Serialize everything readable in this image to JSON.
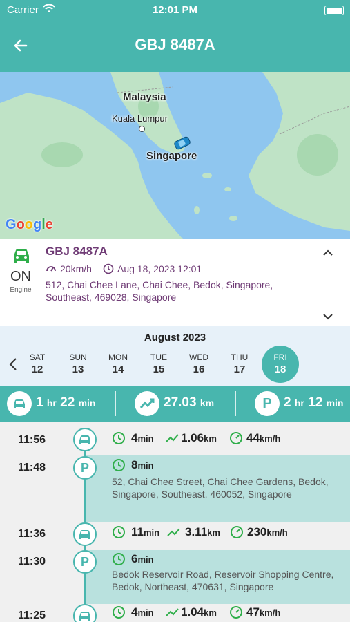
{
  "status_bar": {
    "carrier": "Carrier",
    "time": "12:01 PM"
  },
  "header": {
    "title": "GBJ 8487A",
    "back_icon": "back-arrow-icon"
  },
  "map": {
    "labels": {
      "country": "Malaysia",
      "capital": "Kuala Lumpur",
      "city": "Singapore"
    },
    "provider": "Google"
  },
  "vehicle": {
    "plate": "GBJ 8487A",
    "engine_state": "ON",
    "engine_label": "Engine",
    "speed": "20km/h",
    "timestamp": "Aug 18, 2023 12:01",
    "address": "512, Chai Chee Lane, Chai Chee, Bedok, Singapore, Southeast, 469028, Singapore"
  },
  "calendar": {
    "month": "August 2023",
    "days": [
      {
        "name": "SAT",
        "date": "12"
      },
      {
        "name": "SUN",
        "date": "13"
      },
      {
        "name": "MON",
        "date": "14"
      },
      {
        "name": "TUE",
        "date": "15"
      },
      {
        "name": "WED",
        "date": "16"
      },
      {
        "name": "THU",
        "date": "17"
      },
      {
        "name": "FRI",
        "date": "18"
      }
    ],
    "selected": "FRI 18"
  },
  "summary": {
    "drive": {
      "h": "1",
      "h_unit": "hr",
      "m": "22",
      "m_unit": "min"
    },
    "distance": {
      "value": "27.03",
      "unit": "km"
    },
    "parked": {
      "h": "2",
      "h_unit": "hr",
      "m": "12",
      "m_unit": "min"
    }
  },
  "timeline": [
    {
      "time": "11:56",
      "type": "drive",
      "duration": "4",
      "duration_unit": "min",
      "distance": "1.06",
      "distance_unit": "km",
      "speed": "44",
      "speed_unit": "km/h"
    },
    {
      "time": "11:48",
      "type": "park",
      "duration": "8",
      "duration_unit": "min",
      "address": "52, Chai Chee Street, Chai Chee Gardens, Bedok, Singapore, Southeast, 460052, Singapore"
    },
    {
      "time": "11:36",
      "type": "drive",
      "duration": "11",
      "duration_unit": "min",
      "distance": "3.11",
      "distance_unit": "km",
      "speed": "230",
      "speed_unit": "km/h"
    },
    {
      "time": "11:30",
      "type": "park",
      "duration": "6",
      "duration_unit": "min",
      "address": "Bedok Reservoir Road, Reservoir Shopping Centre, Bedok, Northeast, 470631, Singapore"
    },
    {
      "time": "11:25",
      "type": "drive",
      "duration": "4",
      "duration_unit": "min",
      "distance": "1.04",
      "distance_unit": "km",
      "speed": "47",
      "speed_unit": "km/h"
    }
  ],
  "colors": {
    "accent": "#48b6ae",
    "purple": "#6f3b75",
    "green": "#2fae4a",
    "map_water": "#8fc6ef",
    "map_land": "#bfe3c6"
  }
}
